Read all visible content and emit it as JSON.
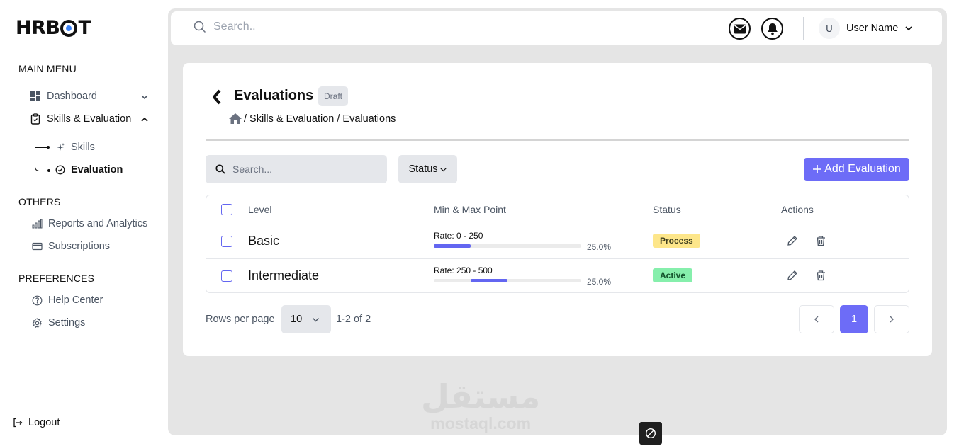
{
  "logo": "HRBOT",
  "sidebar": {
    "main_menu_title": "MAIN MENU",
    "dashboard": "Dashboard",
    "skills_evaluation": "Skills & Evaluation",
    "skills": "Skills",
    "evaluation": "Evaluation",
    "others_title": "OTHERS",
    "reports": "Reports and Analytics",
    "subscriptions": "Subscriptions",
    "preferences_title": "PREFERENCES",
    "help_center": "Help Center",
    "settings": "Settings",
    "logout": "Logout"
  },
  "topbar": {
    "search_placeholder": "Search..",
    "avatar_initial": "U",
    "user_name": "User Name"
  },
  "page": {
    "title": "Evaluations",
    "badge": "Draft",
    "breadcrumb": "/ Skills & Evaluation / Evaluations"
  },
  "toolbar": {
    "search_placeholder": "Search...",
    "status_filter": "Status",
    "add_button": "Add Evaluation"
  },
  "table": {
    "headers": {
      "level": "Level",
      "min_max": "Min & Max Point",
      "status": "Status",
      "actions": "Actions"
    },
    "rows": [
      {
        "level": "Basic",
        "rate": "Rate: 0 - 250",
        "percent_label": "25.0%",
        "progress_start": 0,
        "progress_end": 0.25,
        "status": "Process"
      },
      {
        "level": "Intermediate",
        "rate": "Rate: 250 - 500",
        "percent_label": "25.0%",
        "progress_start": 0.25,
        "progress_end": 0.5,
        "status": "Active"
      }
    ]
  },
  "pagination": {
    "rows_per_page_label": "Rows per page",
    "rows_per_page_value": "10",
    "range": "1-2 of 2",
    "current_page": "1"
  },
  "watermark": {
    "arabic": "مستقل",
    "latin": "mostaql.com"
  },
  "colors": {
    "accent": "#6d6cf7",
    "progress": "#6366f1",
    "process_badge": "#fde68a",
    "active_badge": "#86efac"
  }
}
